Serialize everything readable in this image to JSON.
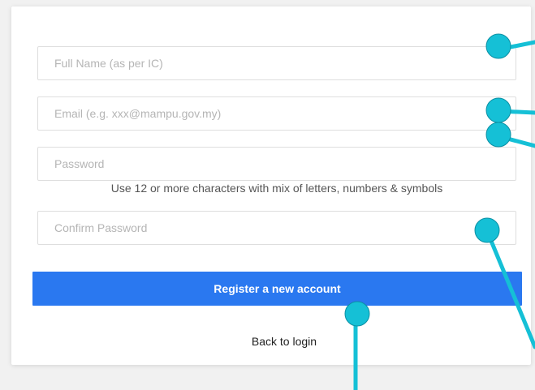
{
  "form": {
    "full_name_placeholder": "Full Name (as per IC)",
    "email_placeholder": "Email (e.g. xxx@mampu.gov.my)",
    "password_placeholder": "Password",
    "password_hint": "Use 12 or more characters with mix of letters, numbers & symbols",
    "confirm_password_placeholder": "Confirm Password",
    "register_label": "Register a new account",
    "back_to_login_label": "Back to login"
  },
  "colors": {
    "primary": "#2a78f0",
    "annotation": "#15c0d6"
  }
}
